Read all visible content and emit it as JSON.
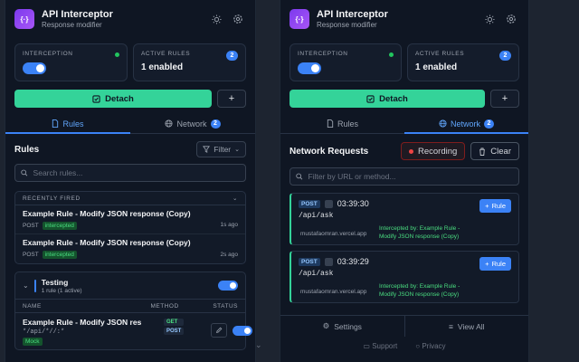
{
  "left": {
    "app_title": "API Interceptor",
    "app_subtitle": "Response modifier",
    "interception_label": "INTERCEPTION",
    "active_rules_label": "ACTIVE RULES",
    "active_rules_count": "2",
    "active_rules_value": "1 enabled",
    "detach_label": "Detach",
    "plus_label": "+",
    "tabs": [
      {
        "label": "Rules"
      },
      {
        "label": "Network",
        "badge": "2"
      }
    ],
    "section_title": "Rules",
    "filter_label": "Filter",
    "search_placeholder": "Search rules...",
    "recently_fired_label": "RECENTLY FIRED",
    "recent": [
      {
        "name": "Example Rule - Modify JSON response (Copy)",
        "method": "POST",
        "status": "intercepted",
        "time": "1s ago"
      },
      {
        "name": "Example Rule - Modify JSON response (Copy)",
        "method": "POST",
        "status": "intercepted",
        "time": "2s ago"
      }
    ],
    "group": {
      "name": "Testing",
      "sub": "1 rule (1 active)"
    },
    "columns": {
      "name": "NAME",
      "method": "METHOD",
      "status": "STATUS"
    },
    "rule": {
      "name": "Example Rule - Modify JSON res",
      "pattern": "*/api/*//:*",
      "tag": "Mock",
      "methods": [
        "GET",
        "POST"
      ]
    }
  },
  "right": {
    "app_title": "API Interceptor",
    "app_subtitle": "Response modifier",
    "interception_label": "INTERCEPTION",
    "active_rules_label": "ACTIVE RULES",
    "active_rules_count": "2",
    "active_rules_value": "1 enabled",
    "detach_label": "Detach",
    "plus_label": "+",
    "tabs": [
      {
        "label": "Rules"
      },
      {
        "label": "Network",
        "badge": "2"
      }
    ],
    "section_title": "Network Requests",
    "recording_label": "Recording",
    "clear_label": "Clear",
    "search_placeholder": "Filter by URL or method...",
    "requests": [
      {
        "method": "POST",
        "time": "03:39:30",
        "path": "/api/ask",
        "host": "mustafaomran.vercel.app",
        "intercepted_line1": "Intercepted by: Example Rule -",
        "intercepted_line2": "Modify JSON response (Copy)",
        "rule_btn": "Rule"
      },
      {
        "method": "POST",
        "time": "03:39:29",
        "path": "/api/ask",
        "host": "mustafaomran.vercel.app",
        "intercepted_line1": "Intercepted by: Example Rule -",
        "intercepted_line2": "Modify JSON response (Copy)",
        "rule_btn": "Rule"
      }
    ],
    "footer": {
      "settings": "Settings",
      "view_all": "View All",
      "support": "Support",
      "privacy": "Privacy"
    }
  },
  "colors": {
    "accent": "#3b82f6",
    "green": "#34d399",
    "bg": "#0f1623"
  }
}
